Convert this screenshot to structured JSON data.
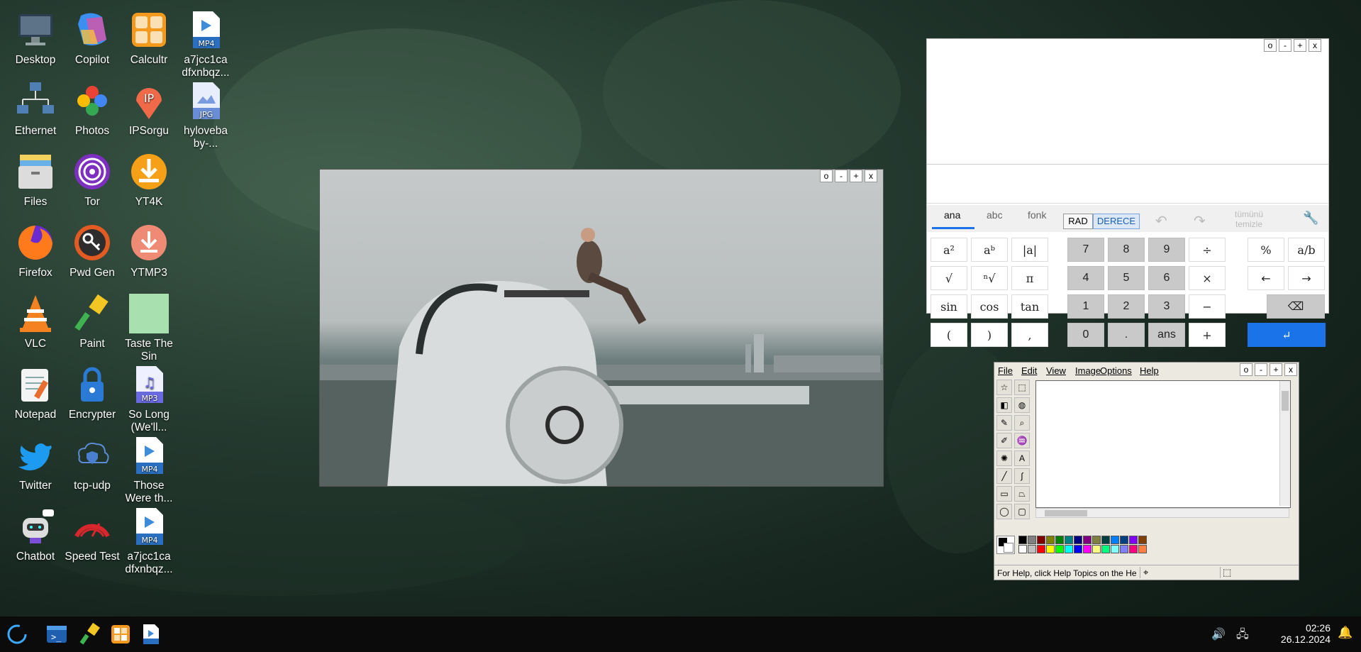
{
  "desktop_icons": [
    {
      "label": "Desktop",
      "icon": "monitor-icon"
    },
    {
      "label": "Copilot",
      "icon": "copilot-icon"
    },
    {
      "label": "Calcultr",
      "icon": "calculator-icon"
    },
    {
      "label": "a7jcc1ca dfxnbqz...",
      "icon": "mp4-file-icon"
    },
    {
      "label": "Ethernet",
      "icon": "network-icon"
    },
    {
      "label": "Photos",
      "icon": "photos-icon"
    },
    {
      "label": "IPSorgu",
      "icon": "ip-location-icon"
    },
    {
      "label": "hyloveba by-...",
      "icon": "jpg-file-icon"
    },
    {
      "label": "Files",
      "icon": "files-icon"
    },
    {
      "label": "Tor",
      "icon": "tor-icon"
    },
    {
      "label": "YT4K",
      "icon": "download-icon"
    },
    {
      "label": "Firefox",
      "icon": "firefox-icon"
    },
    {
      "label": "Pwd Gen",
      "icon": "key-icon"
    },
    {
      "label": "YTMP3",
      "icon": "download-mp3-icon"
    },
    {
      "label": "VLC",
      "icon": "vlc-icon"
    },
    {
      "label": "Paint",
      "icon": "paint-brush-icon"
    },
    {
      "label": "Taste The Sin",
      "icon": "green-image-icon"
    },
    {
      "label": "Notepad",
      "icon": "notepad-icon"
    },
    {
      "label": "Encrypter",
      "icon": "lock-icon"
    },
    {
      "label": "So Long (We'll...",
      "icon": "mp3-file-icon"
    },
    {
      "label": "Twitter",
      "icon": "twitter-icon"
    },
    {
      "label": "tcp-udp",
      "icon": "shield-cloud-icon"
    },
    {
      "label": "Those Were th...",
      "icon": "mp4-file-icon"
    },
    {
      "label": "Chatbot",
      "icon": "robot-icon"
    },
    {
      "label": "Speed Test",
      "icon": "speedometer-icon"
    },
    {
      "label": "a7jcc1ca dfxnbqz...",
      "icon": "mp4-file-icon"
    }
  ],
  "window_buttons": {
    "o": "o",
    "min": "-",
    "max": "+",
    "close": "x"
  },
  "calculator": {
    "tabs": [
      "ana",
      "abc",
      "fonk"
    ],
    "rad": "RAD",
    "derece": "DERECE",
    "clear_all": "tümünü temizle",
    "func_keys": [
      "a²",
      "aᵇ",
      "|a|",
      "√",
      "ⁿ√",
      "π",
      "sin",
      "cos",
      "tan",
      "(",
      ")",
      ","
    ],
    "num_keys": [
      "7",
      "8",
      "9",
      "÷",
      "4",
      "5",
      "6",
      "×",
      "1",
      "2",
      "3",
      "−",
      "0",
      ".",
      "ans",
      "+"
    ],
    "side_keys": [
      "%",
      "a/b",
      "←",
      "→",
      "⌫",
      "↵"
    ]
  },
  "paint": {
    "menu": [
      "File",
      "Edit",
      "View",
      "Image",
      "Options",
      "Help"
    ],
    "status": "For Help, click Help Topics on the He",
    "colors": [
      "#000000",
      "#808080",
      "#800000",
      "#808000",
      "#008000",
      "#008080",
      "#000080",
      "#800080",
      "#808040",
      "#004040",
      "#0080ff",
      "#004080",
      "#8000ff",
      "#804000",
      "#ffffff",
      "#c0c0c0",
      "#ff0000",
      "#ffff00",
      "#00ff00",
      "#00ffff",
      "#0000ff",
      "#ff00ff",
      "#ffff80",
      "#00ff80",
      "#80ffff",
      "#8080ff",
      "#ff0080",
      "#ff8040"
    ]
  },
  "taskbar": {
    "time": "02:26",
    "date": "26.12.2024",
    "items": [
      "start-icon",
      "terminal-icon",
      "paint-brush-icon",
      "calculator-icon",
      "mp4-file-icon"
    ]
  }
}
